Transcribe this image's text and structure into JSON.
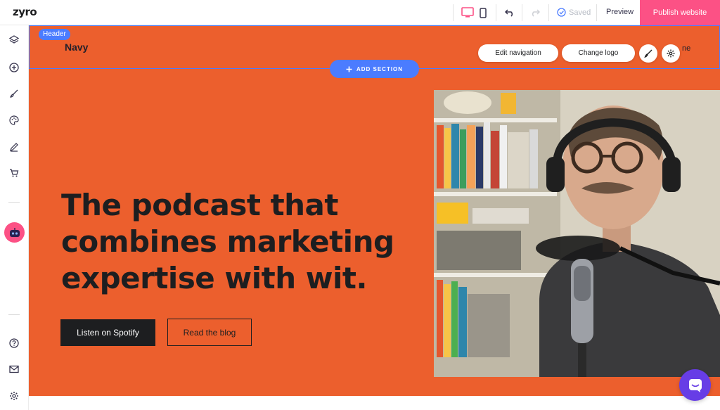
{
  "app": {
    "logo": "zyro"
  },
  "toolbar": {
    "saved_label": "Saved",
    "preview_label": "Preview",
    "publish_label": "Publish website"
  },
  "editor": {
    "header_tag": "Header",
    "edit_navigation": "Edit navigation",
    "change_logo": "Change logo",
    "add_section": "ADD SECTION",
    "nav_peek": "ne"
  },
  "site": {
    "brand": "Navy",
    "headline": "The podcast that combines marketing expertise with wit.",
    "cta_primary": "Listen on Spotify",
    "cta_secondary": "Read the blog"
  },
  "colors": {
    "accent_orange": "#ec5f2d",
    "publish_pink": "#fc5185",
    "editor_blue": "#4b7cff",
    "chat_purple": "#673de6",
    "dark": "#1d1e20"
  }
}
